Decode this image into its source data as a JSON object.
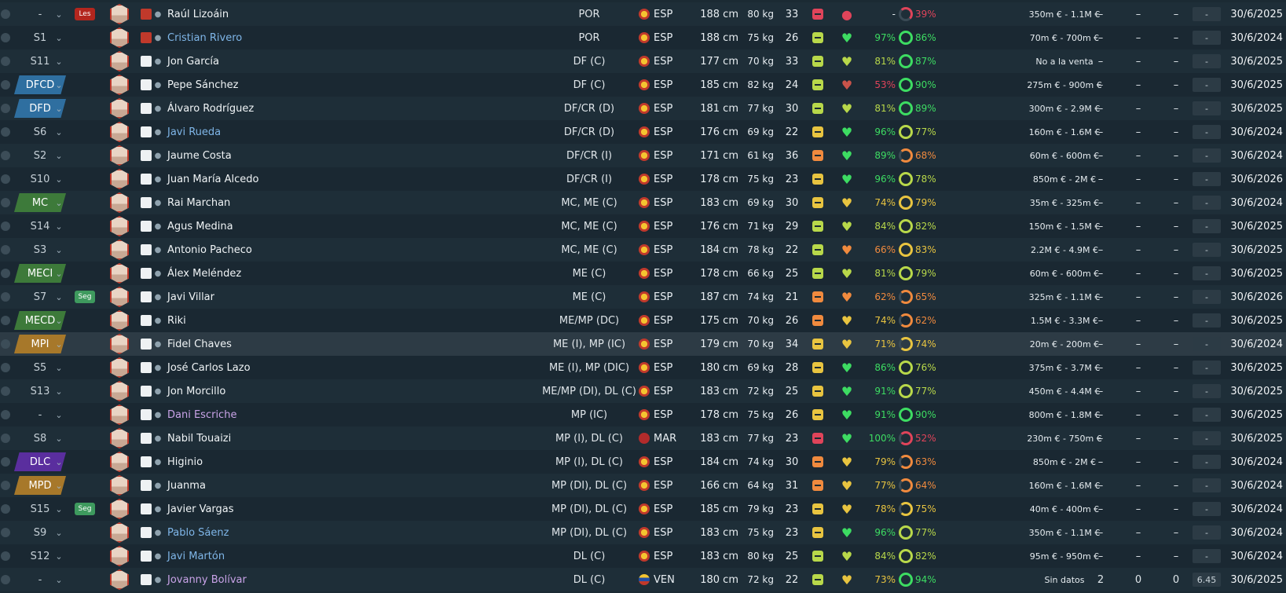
{
  "columns_visible": [
    "selection",
    "position",
    "tag",
    "face",
    "shirt",
    "name",
    "positions",
    "nationality",
    "height",
    "weight",
    "age",
    "status",
    "morale",
    "condition",
    "fitness",
    "value",
    "apps",
    "goals",
    "assists",
    "rating",
    "contract"
  ],
  "colors": {
    "green": "#3ddc62",
    "lime": "#b8d84a",
    "yellow": "#e8c440",
    "orange": "#f08a3e",
    "red": "#e0445a",
    "badge_blue": "#2f6fa0",
    "badge_green": "#3d7a3a",
    "badge_gold": "#a7782a",
    "badge_purple": "#5a2e9e"
  },
  "rows": [
    {
      "pos": "-",
      "pos_style": "none",
      "tag": "Les",
      "tag_color": "#b3261e",
      "shirt": "red",
      "name": "Raúl Lizoáin",
      "name_color": "white",
      "positions": "POR",
      "flag": "esp",
      "nat": "ESP",
      "height": "188 cm",
      "weight": "80 kg",
      "age": "33",
      "status_color": "#e0445a",
      "status_icon": "injury-icon",
      "heart": "●",
      "heart_color": "#e0445a",
      "pct": "-",
      "pct_color": "#e8eef2",
      "ring_color": "#e0445a",
      "ring_pct": "39%",
      "value": "350m € - 1.1M €",
      "c1": "–",
      "c2": "–",
      "c3": "–",
      "rating": "-",
      "contract": "30/6/2025"
    },
    {
      "pos": "S1",
      "pos_style": "none",
      "tag": "",
      "tag_color": "",
      "shirt": "red",
      "name": "Cristian Rivero",
      "name_color": "blue",
      "positions": "POR",
      "flag": "esp",
      "nat": "ESP",
      "height": "188 cm",
      "weight": "75 kg",
      "age": "26",
      "status_color": "#b8d84a",
      "status_icon": "",
      "heart": "♥",
      "heart_color": "#3ddc62",
      "pct": "97%",
      "pct_color": "#3ddc62",
      "ring_color": "#3ddc62",
      "ring_pct": "86%",
      "value": "70m € - 700m €",
      "c1": "–",
      "c2": "–",
      "c3": "–",
      "rating": "-",
      "contract": "30/6/2024"
    },
    {
      "pos": "S11",
      "pos_style": "none",
      "tag": "",
      "tag_color": "",
      "shirt": "white",
      "name": "Jon García",
      "name_color": "white",
      "positions": "DF (C)",
      "flag": "esp",
      "nat": "ESP",
      "height": "177 cm",
      "weight": "70 kg",
      "age": "33",
      "status_color": "#b8d84a",
      "status_icon": "",
      "heart": "♥",
      "heart_color": "#b8d84a",
      "pct": "81%",
      "pct_color": "#b8d84a",
      "ring_color": "#3ddc62",
      "ring_pct": "87%",
      "value": "No a la venta",
      "c1": "–",
      "c2": "–",
      "c3": "–",
      "rating": "-",
      "contract": "30/6/2025"
    },
    {
      "pos": "DFCD",
      "pos_style": "blue",
      "tag": "",
      "tag_color": "",
      "shirt": "white",
      "name": "Pepe Sánchez",
      "name_color": "white",
      "positions": "DF (C)",
      "flag": "esp",
      "nat": "ESP",
      "height": "185 cm",
      "weight": "82 kg",
      "age": "24",
      "status_color": "#b8d84a",
      "status_icon": "",
      "heart": "♥",
      "heart_color": "#c9534a",
      "pct": "53%",
      "pct_color": "#e0445a",
      "ring_color": "#3ddc62",
      "ring_pct": "90%",
      "value": "275m € - 900m €",
      "c1": "–",
      "c2": "–",
      "c3": "–",
      "rating": "-",
      "contract": "30/6/2025"
    },
    {
      "pos": "DFD",
      "pos_style": "blue",
      "tag": "",
      "tag_color": "",
      "shirt": "white",
      "name": "Álvaro Rodríguez",
      "name_color": "white",
      "positions": "DF/CR (D)",
      "flag": "esp",
      "nat": "ESP",
      "height": "181 cm",
      "weight": "77 kg",
      "age": "30",
      "status_color": "#b8d84a",
      "status_icon": "",
      "heart": "♥",
      "heart_color": "#b8d84a",
      "pct": "81%",
      "pct_color": "#b8d84a",
      "ring_color": "#3ddc62",
      "ring_pct": "89%",
      "value": "300m € - 2.9M €",
      "c1": "–",
      "c2": "–",
      "c3": "–",
      "rating": "-",
      "contract": "30/6/2025"
    },
    {
      "pos": "S6",
      "pos_style": "none",
      "tag": "",
      "tag_color": "",
      "shirt": "white",
      "name": "Javi Rueda",
      "name_color": "blue",
      "positions": "DF/CR (D)",
      "flag": "esp",
      "nat": "ESP",
      "height": "176 cm",
      "weight": "69 kg",
      "age": "22",
      "status_color": "#e8c440",
      "status_icon": "",
      "heart": "♥",
      "heart_color": "#3ddc62",
      "pct": "96%",
      "pct_color": "#3ddc62",
      "ring_color": "#b8d84a",
      "ring_pct": "77%",
      "value": "160m € - 1.6M €",
      "c1": "–",
      "c2": "–",
      "c3": "–",
      "rating": "-",
      "contract": "30/6/2024"
    },
    {
      "pos": "S2",
      "pos_style": "none",
      "tag": "",
      "tag_color": "",
      "shirt": "white",
      "name": "Jaume Costa",
      "name_color": "white",
      "positions": "DF/CR (I)",
      "flag": "esp",
      "nat": "ESP",
      "height": "171 cm",
      "weight": "61 kg",
      "age": "36",
      "status_color": "#f08a3e",
      "status_icon": "",
      "heart": "♥",
      "heart_color": "#3ddc62",
      "pct": "89%",
      "pct_color": "#3ddc62",
      "ring_color": "#f08a3e",
      "ring_pct": "68%",
      "value": "60m € - 600m €",
      "c1": "–",
      "c2": "–",
      "c3": "–",
      "rating": "-",
      "contract": "30/6/2024"
    },
    {
      "pos": "S10",
      "pos_style": "none",
      "tag": "",
      "tag_color": "",
      "shirt": "white",
      "name": "Juan María Alcedo",
      "name_color": "white",
      "positions": "DF/CR (I)",
      "flag": "esp",
      "nat": "ESP",
      "height": "178 cm",
      "weight": "75 kg",
      "age": "23",
      "status_color": "#e8c440",
      "status_icon": "",
      "heart": "♥",
      "heart_color": "#3ddc62",
      "pct": "96%",
      "pct_color": "#3ddc62",
      "ring_color": "#b8d84a",
      "ring_pct": "78%",
      "value": "850m € - 2M €",
      "c1": "–",
      "c2": "–",
      "c3": "–",
      "rating": "-",
      "contract": "30/6/2026"
    },
    {
      "pos": "MC",
      "pos_style": "green",
      "tag": "",
      "tag_color": "",
      "shirt": "white",
      "name": "Rai Marchan",
      "name_color": "white",
      "positions": "MC, ME (C)",
      "flag": "esp",
      "nat": "ESP",
      "height": "183 cm",
      "weight": "69 kg",
      "age": "30",
      "status_color": "#e8c440",
      "status_icon": "",
      "heart": "♥",
      "heart_color": "#e8c440",
      "pct": "74%",
      "pct_color": "#e8c440",
      "ring_color": "#e8c440",
      "ring_pct": "79%",
      "value": "35m € - 325m €",
      "c1": "–",
      "c2": "–",
      "c3": "–",
      "rating": "-",
      "contract": "30/6/2024"
    },
    {
      "pos": "S14",
      "pos_style": "none",
      "tag": "",
      "tag_color": "",
      "shirt": "white",
      "name": "Agus Medina",
      "name_color": "white",
      "positions": "MC, ME (C)",
      "flag": "esp",
      "nat": "ESP",
      "height": "176 cm",
      "weight": "71 kg",
      "age": "29",
      "status_color": "#b8d84a",
      "status_icon": "",
      "heart": "♥",
      "heart_color": "#b8d84a",
      "pct": "84%",
      "pct_color": "#b8d84a",
      "ring_color": "#b8d84a",
      "ring_pct": "82%",
      "value": "150m € - 1.5M €",
      "c1": "–",
      "c2": "–",
      "c3": "–",
      "rating": "-",
      "contract": "30/6/2025"
    },
    {
      "pos": "S3",
      "pos_style": "none",
      "tag": "",
      "tag_color": "",
      "shirt": "white",
      "name": "Antonio Pacheco",
      "name_color": "white",
      "positions": "MC, ME (C)",
      "flag": "esp",
      "nat": "ESP",
      "height": "184 cm",
      "weight": "78 kg",
      "age": "22",
      "status_color": "#b8d84a",
      "status_icon": "",
      "heart": "♥",
      "heart_color": "#f08a3e",
      "pct": "66%",
      "pct_color": "#f08a3e",
      "ring_color": "#e8c440",
      "ring_pct": "83%",
      "value": "2.2M € - 4.9M €",
      "c1": "–",
      "c2": "–",
      "c3": "–",
      "rating": "-",
      "contract": "30/6/2025"
    },
    {
      "pos": "MECI",
      "pos_style": "green",
      "tag": "",
      "tag_color": "",
      "shirt": "white",
      "name": "Álex Meléndez",
      "name_color": "white",
      "positions": "ME (C)",
      "flag": "esp",
      "nat": "ESP",
      "height": "178 cm",
      "weight": "66 kg",
      "age": "25",
      "status_color": "#b8d84a",
      "status_icon": "",
      "heart": "♥",
      "heart_color": "#b8d84a",
      "pct": "81%",
      "pct_color": "#b8d84a",
      "ring_color": "#b8d84a",
      "ring_pct": "79%",
      "value": "60m € - 600m €",
      "c1": "–",
      "c2": "–",
      "c3": "–",
      "rating": "-",
      "contract": "30/6/2025"
    },
    {
      "pos": "S7",
      "pos_style": "none",
      "tag": "Seg",
      "tag_color": "#3e9a5e",
      "shirt": "white",
      "name": "Javi Villar",
      "name_color": "white",
      "positions": "ME (C)",
      "flag": "esp",
      "nat": "ESP",
      "height": "187 cm",
      "weight": "74 kg",
      "age": "21",
      "status_color": "#f08a3e",
      "status_icon": "",
      "heart": "♥",
      "heart_color": "#f08a3e",
      "pct": "62%",
      "pct_color": "#f08a3e",
      "ring_color": "#f08a3e",
      "ring_pct": "65%",
      "value": "325m € - 1.1M €",
      "c1": "–",
      "c2": "–",
      "c3": "–",
      "rating": "-",
      "contract": "30/6/2026"
    },
    {
      "pos": "MECD",
      "pos_style": "green",
      "tag": "",
      "tag_color": "",
      "shirt": "white",
      "name": "Riki",
      "name_color": "white",
      "positions": "ME/MP (DC)",
      "flag": "esp",
      "nat": "ESP",
      "height": "175 cm",
      "weight": "70 kg",
      "age": "26",
      "status_color": "#f08a3e",
      "status_icon": "",
      "heart": "♥",
      "heart_color": "#e8c440",
      "pct": "74%",
      "pct_color": "#e8c440",
      "ring_color": "#f08a3e",
      "ring_pct": "62%",
      "value": "1.5M € - 3.3M €",
      "c1": "–",
      "c2": "–",
      "c3": "–",
      "rating": "-",
      "contract": "30/6/2025"
    },
    {
      "pos": "MPI",
      "pos_style": "gold",
      "tag": "",
      "tag_color": "",
      "shirt": "white",
      "name": "Fidel Chaves",
      "name_color": "white",
      "positions": "ME (I), MP (IC)",
      "flag": "esp",
      "nat": "ESP",
      "height": "179 cm",
      "weight": "70 kg",
      "age": "34",
      "status_color": "#e8c440",
      "status_icon": "",
      "heart": "♥",
      "heart_color": "#e8c440",
      "pct": "71%",
      "pct_color": "#e8c440",
      "ring_color": "#e8c440",
      "ring_pct": "74%",
      "value": "20m € - 200m €",
      "c1": "–",
      "c2": "–",
      "c3": "–",
      "rating": "-",
      "contract": "30/6/2024",
      "highlight": true
    },
    {
      "pos": "S5",
      "pos_style": "none",
      "tag": "",
      "tag_color": "",
      "shirt": "white",
      "name": "José Carlos Lazo",
      "name_color": "white",
      "positions": "ME (I), MP (DIC)",
      "flag": "esp",
      "nat": "ESP",
      "height": "180 cm",
      "weight": "69 kg",
      "age": "28",
      "status_color": "#e8c440",
      "status_icon": "",
      "heart": "♥",
      "heart_color": "#3ddc62",
      "pct": "86%",
      "pct_color": "#3ddc62",
      "ring_color": "#b8d84a",
      "ring_pct": "76%",
      "value": "375m € - 3.7M €",
      "c1": "–",
      "c2": "–",
      "c3": "–",
      "rating": "-",
      "contract": "30/6/2025"
    },
    {
      "pos": "S13",
      "pos_style": "none",
      "tag": "",
      "tag_color": "",
      "shirt": "white",
      "name": "Jon Morcillo",
      "name_color": "white",
      "positions": "ME/MP (DI), DL (C)",
      "flag": "esp",
      "nat": "ESP",
      "height": "183 cm",
      "weight": "72 kg",
      "age": "25",
      "status_color": "#e8c440",
      "status_icon": "",
      "heart": "♥",
      "heart_color": "#3ddc62",
      "pct": "91%",
      "pct_color": "#3ddc62",
      "ring_color": "#b8d84a",
      "ring_pct": "77%",
      "value": "450m € - 4.4M €",
      "c1": "–",
      "c2": "–",
      "c3": "–",
      "rating": "-",
      "contract": "30/6/2025"
    },
    {
      "pos": "-",
      "pos_style": "none",
      "tag": "",
      "tag_color": "",
      "shirt": "white",
      "name": "Dani Escriche",
      "name_color": "purple",
      "positions": "MP (IC)",
      "flag": "esp",
      "nat": "ESP",
      "height": "178 cm",
      "weight": "75 kg",
      "age": "26",
      "status_color": "#e8c440",
      "status_icon": "",
      "heart": "♥",
      "heart_color": "#3ddc62",
      "pct": "91%",
      "pct_color": "#3ddc62",
      "ring_color": "#3ddc62",
      "ring_pct": "90%",
      "value": "800m € - 1.8M €",
      "c1": "–",
      "c2": "–",
      "c3": "–",
      "rating": "-",
      "contract": "30/6/2025"
    },
    {
      "pos": "S8",
      "pos_style": "none",
      "tag": "",
      "tag_color": "",
      "shirt": "white",
      "name": "Nabil Touaizi",
      "name_color": "white",
      "positions": "MP (I), DL (C)",
      "flag": "mar",
      "nat": "MAR",
      "height": "183 cm",
      "weight": "77 kg",
      "age": "23",
      "status_color": "#e0445a",
      "status_icon": "injury-icon",
      "heart": "♥",
      "heart_color": "#3ddc62",
      "pct": "100%",
      "pct_color": "#3ddc62",
      "ring_color": "#e0445a",
      "ring_pct": "52%",
      "value": "230m € - 750m €",
      "c1": "–",
      "c2": "–",
      "c3": "–",
      "rating": "-",
      "contract": "30/6/2025"
    },
    {
      "pos": "DLC",
      "pos_style": "purple",
      "tag": "",
      "tag_color": "",
      "shirt": "white",
      "name": "Higinio",
      "name_color": "white",
      "positions": "MP (I), DL (C)",
      "flag": "esp",
      "nat": "ESP",
      "height": "184 cm",
      "weight": "74 kg",
      "age": "30",
      "status_color": "#f08a3e",
      "status_icon": "",
      "heart": "♥",
      "heart_color": "#e8c440",
      "pct": "79%",
      "pct_color": "#e8c440",
      "ring_color": "#f08a3e",
      "ring_pct": "63%",
      "value": "850m € - 2M €",
      "c1": "–",
      "c2": "–",
      "c3": "–",
      "rating": "-",
      "contract": "30/6/2024"
    },
    {
      "pos": "MPD",
      "pos_style": "gold",
      "tag": "",
      "tag_color": "",
      "shirt": "white",
      "name": "Juanma",
      "name_color": "white",
      "positions": "MP (DI), DL (C)",
      "flag": "esp",
      "nat": "ESP",
      "height": "166 cm",
      "weight": "64 kg",
      "age": "31",
      "status_color": "#f08a3e",
      "status_icon": "",
      "heart": "♥",
      "heart_color": "#e8c440",
      "pct": "77%",
      "pct_color": "#e8c440",
      "ring_color": "#f08a3e",
      "ring_pct": "64%",
      "value": "160m € - 1.6M €",
      "c1": "–",
      "c2": "–",
      "c3": "–",
      "rating": "-",
      "contract": "30/6/2024"
    },
    {
      "pos": "S15",
      "pos_style": "none",
      "tag": "Seg",
      "tag_color": "#3e9a5e",
      "shirt": "white",
      "name": "Javier Vargas",
      "name_color": "white",
      "positions": "MP (DI), DL (C)",
      "flag": "esp",
      "nat": "ESP",
      "height": "185 cm",
      "weight": "79 kg",
      "age": "23",
      "status_color": "#e8c440",
      "status_icon": "",
      "heart": "♥",
      "heart_color": "#e8c440",
      "pct": "78%",
      "pct_color": "#e8c440",
      "ring_color": "#e8c440",
      "ring_pct": "75%",
      "value": "40m € - 400m €",
      "c1": "–",
      "c2": "–",
      "c3": "–",
      "rating": "-",
      "contract": "30/6/2024"
    },
    {
      "pos": "S9",
      "pos_style": "none",
      "tag": "",
      "tag_color": "",
      "shirt": "white",
      "name": "Pablo Sáenz",
      "name_color": "blue",
      "positions": "MP (DI), DL (C)",
      "flag": "esp",
      "nat": "ESP",
      "height": "183 cm",
      "weight": "75 kg",
      "age": "23",
      "status_color": "#e8c440",
      "status_icon": "",
      "heart": "♥",
      "heart_color": "#3ddc62",
      "pct": "96%",
      "pct_color": "#3ddc62",
      "ring_color": "#b8d84a",
      "ring_pct": "77%",
      "value": "350m € - 1.1M €",
      "c1": "–",
      "c2": "–",
      "c3": "–",
      "rating": "-",
      "contract": "30/6/2024"
    },
    {
      "pos": "S12",
      "pos_style": "none",
      "tag": "",
      "tag_color": "",
      "shirt": "white",
      "name": "Javi Martón",
      "name_color": "blue",
      "positions": "DL (C)",
      "flag": "esp",
      "nat": "ESP",
      "height": "183 cm",
      "weight": "80 kg",
      "age": "25",
      "status_color": "#b8d84a",
      "status_icon": "",
      "heart": "♥",
      "heart_color": "#b8d84a",
      "pct": "84%",
      "pct_color": "#b8d84a",
      "ring_color": "#b8d84a",
      "ring_pct": "82%",
      "value": "95m € - 950m €",
      "c1": "–",
      "c2": "–",
      "c3": "–",
      "rating": "-",
      "contract": "30/6/2024"
    },
    {
      "pos": "-",
      "pos_style": "none",
      "tag": "",
      "tag_color": "",
      "shirt": "white",
      "name": "Jovanny Bolívar",
      "name_color": "purple",
      "positions": "DL (C)",
      "flag": "ven",
      "nat": "VEN",
      "height": "180 cm",
      "weight": "72 kg",
      "age": "22",
      "status_color": "#b8d84a",
      "status_icon": "",
      "heart": "♥",
      "heart_color": "#e8c440",
      "pct": "73%",
      "pct_color": "#e8c440",
      "ring_color": "#3ddc62",
      "ring_pct": "94%",
      "value": "Sin datos",
      "c1": "2",
      "c2": "0",
      "c3": "0",
      "rating": "6.45",
      "contract": "30/6/2025"
    }
  ]
}
